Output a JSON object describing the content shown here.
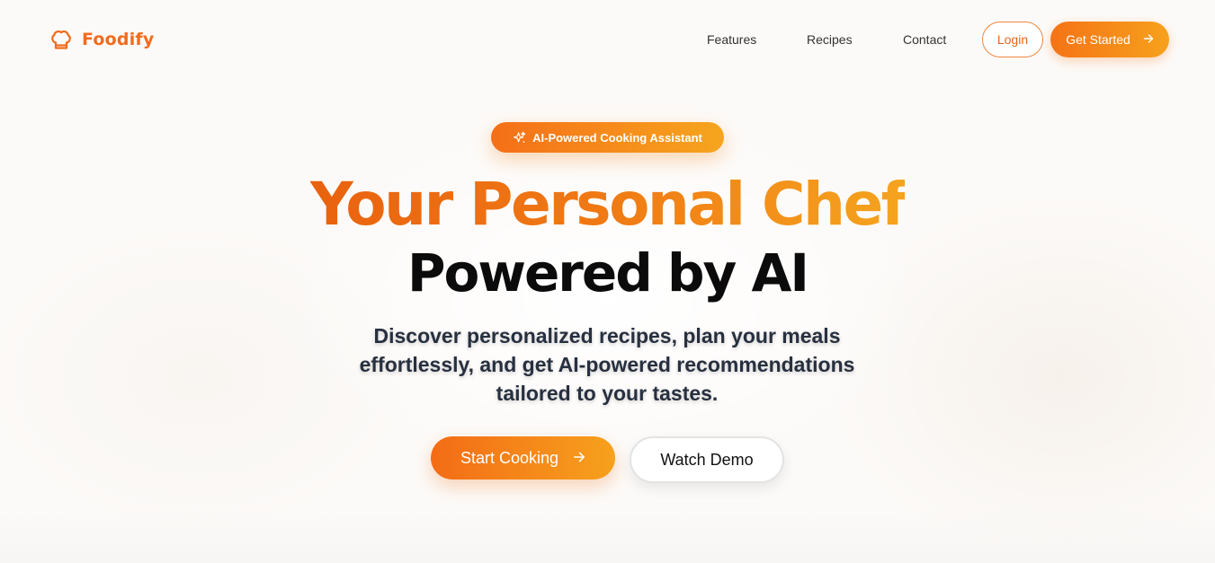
{
  "brand": {
    "name": "Foodify",
    "icon": "chef-hat-icon",
    "color": "#f26b1d"
  },
  "nav": {
    "links": [
      "Features",
      "Recipes",
      "Contact"
    ],
    "login_label": "Login",
    "get_started_label": "Get Started"
  },
  "hero": {
    "badge": "AI-Powered Cooking Assistant",
    "badge_icon": "sparkles-icon",
    "headline_line1": "Your Personal Chef",
    "headline_line2": "Powered by AI",
    "subtitle": "Discover personalized recipes, plan your meals effortlessly, and get AI-powered recommendations tailored to your tastes.",
    "primary_cta": "Start Cooking",
    "secondary_cta": "Watch Demo"
  },
  "colors": {
    "accent_start": "#f46c16",
    "accent_end": "#f6a11d",
    "headline_dark": "#0b0b0b",
    "subtitle": "#27303f"
  }
}
